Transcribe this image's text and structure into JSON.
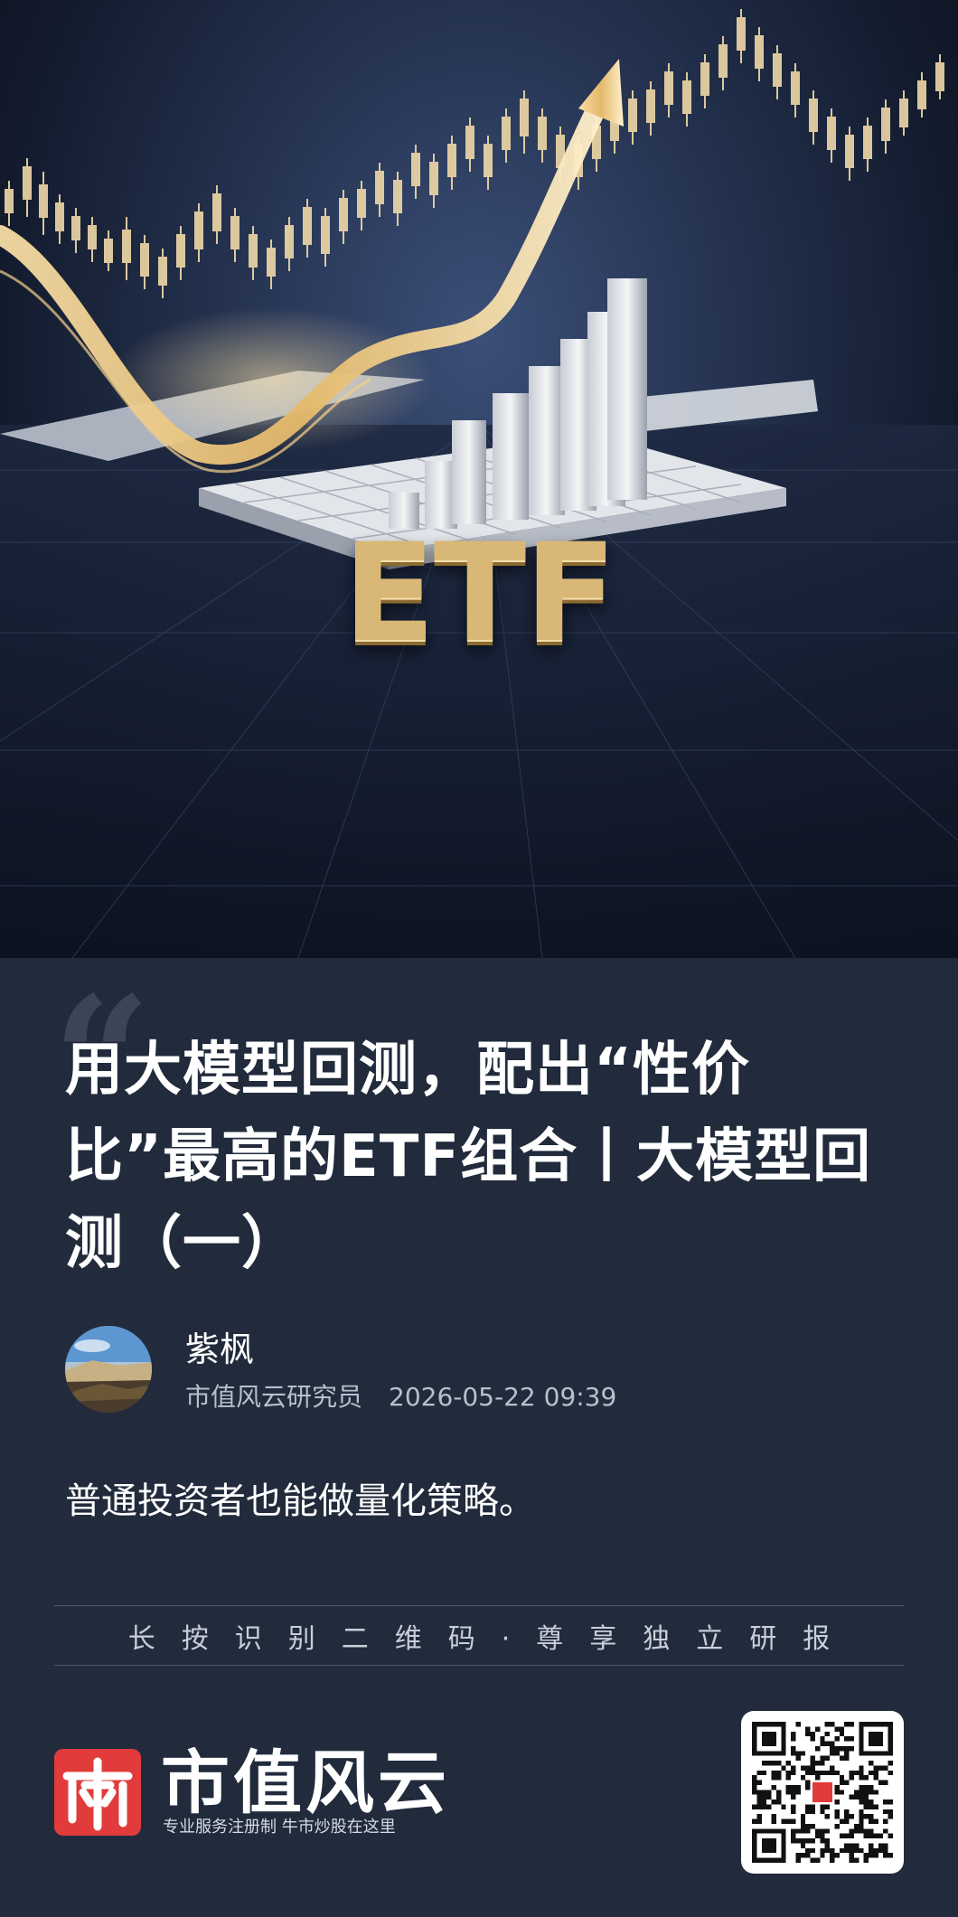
{
  "hero": {
    "image_label": "ETF"
  },
  "article": {
    "title": "用大模型回测，配出“性价比”最高的ETF组合丨大模型回测（一）",
    "author": {
      "name": "紫枫",
      "role": "市值风云研究员",
      "date": "2026-05-22 09:39"
    },
    "summary": "普通投资者也能做量化策略。"
  },
  "footer": {
    "tagline": "长按识别二维码·尊享独立研报",
    "brand_name": "市值风云",
    "brand_slogan": "专业服务注册制  牛市炒股在这里",
    "qr_icon": "qr-code-icon"
  },
  "colors": {
    "background": "#212b3c",
    "brand_red": "#e23b3b",
    "gold": "#d9b877"
  }
}
